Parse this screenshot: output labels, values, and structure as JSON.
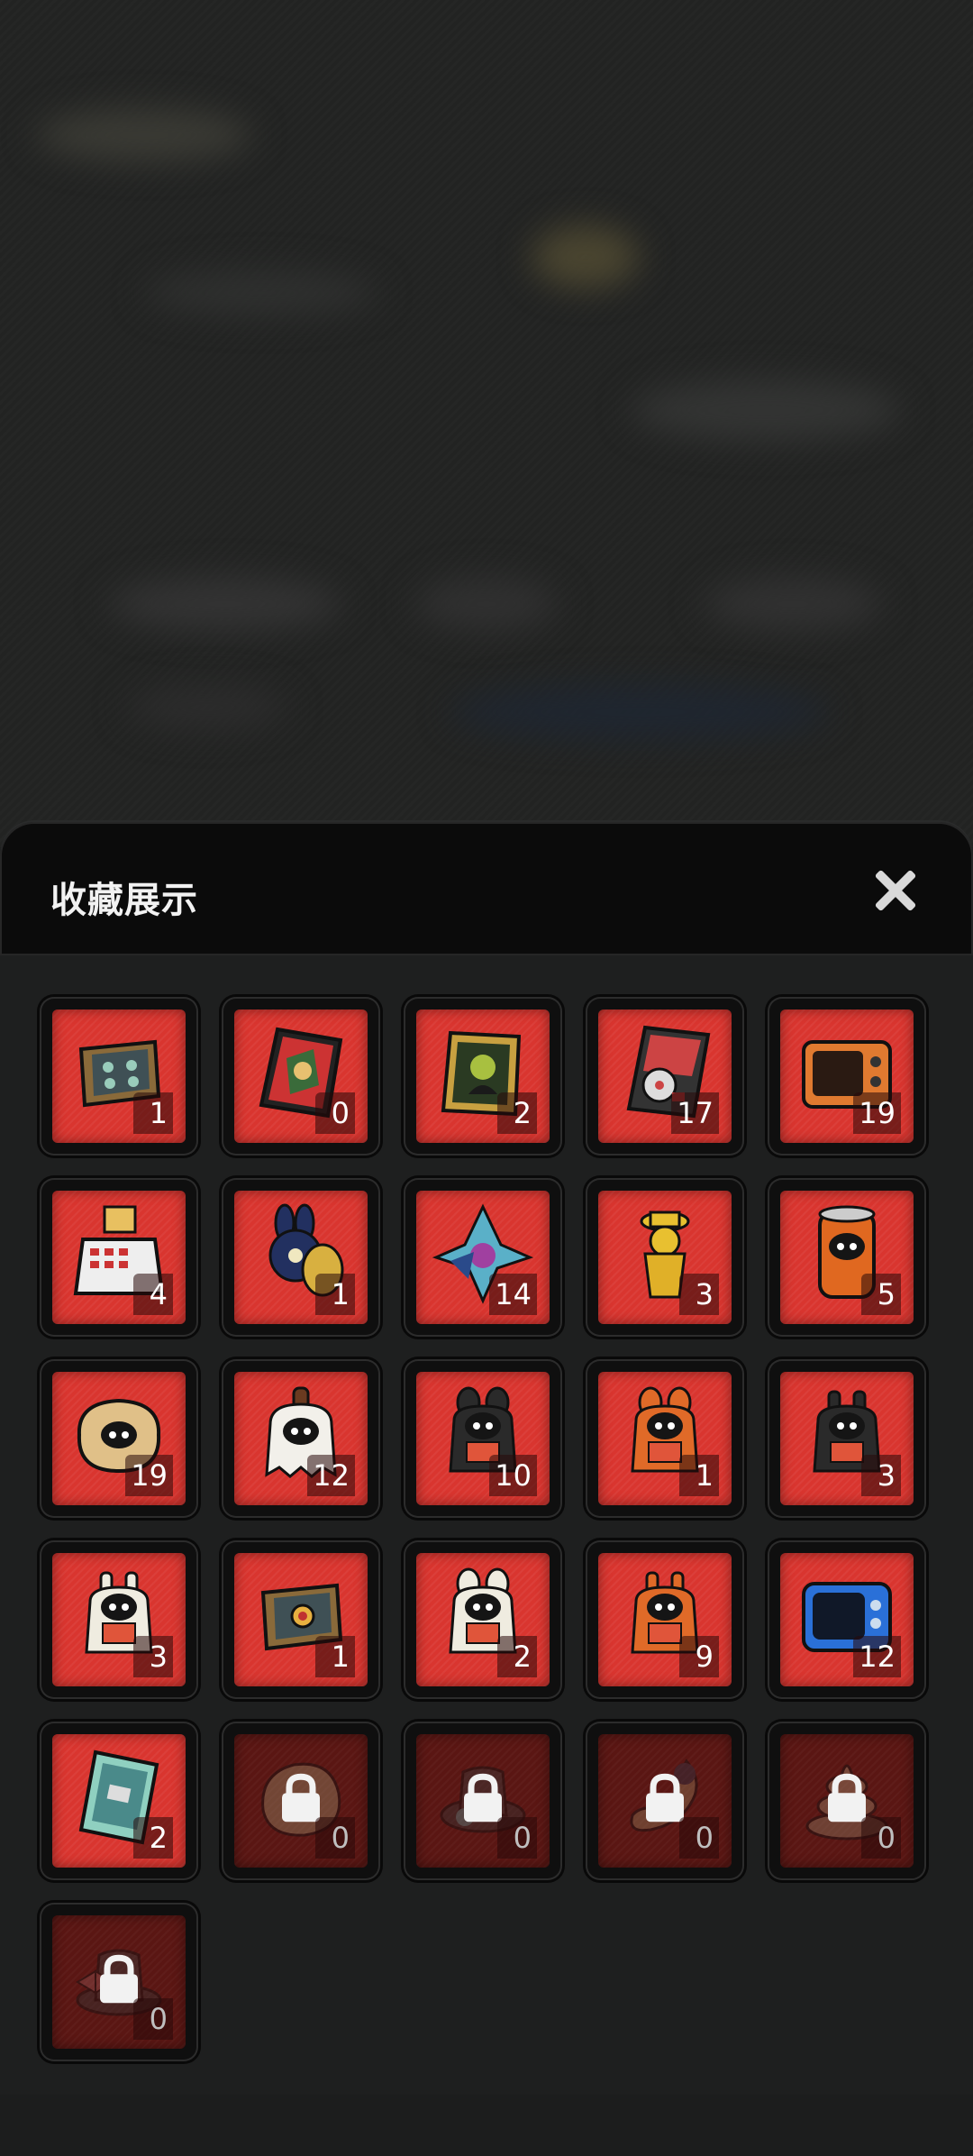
{
  "panel": {
    "title": "收藏展示",
    "close_icon": "close-icon"
  },
  "items": [
    {
      "icon": "tablet-frame-icon",
      "count": "1",
      "locked": false
    },
    {
      "icon": "comic-book-icon",
      "count": "0",
      "locked": false
    },
    {
      "icon": "portrait-frame-icon",
      "count": "2",
      "locked": false
    },
    {
      "icon": "record-album-icon",
      "count": "17",
      "locked": false
    },
    {
      "icon": "retro-tv-icon",
      "count": "19",
      "locked": false
    },
    {
      "icon": "cash-register-icon",
      "count": "4",
      "locked": false
    },
    {
      "icon": "rabbit-figure-icon",
      "count": "1",
      "locked": false
    },
    {
      "icon": "crystal-bird-icon",
      "count": "14",
      "locked": false
    },
    {
      "icon": "golden-detective-icon",
      "count": "3",
      "locked": false
    },
    {
      "icon": "soda-can-icon",
      "count": "5",
      "locked": false
    },
    {
      "icon": "sponge-creature-icon",
      "count": "19",
      "locked": false
    },
    {
      "icon": "ghost-figure-icon",
      "count": "12",
      "locked": false
    },
    {
      "icon": "black-costume-icon",
      "count": "10",
      "locked": false
    },
    {
      "icon": "orange-costume-icon",
      "count": "1",
      "locked": false
    },
    {
      "icon": "black-robot-costume-icon",
      "count": "3",
      "locked": false
    },
    {
      "icon": "white-robot-costume-icon",
      "count": "3",
      "locked": false
    },
    {
      "icon": "gem-frame-icon",
      "count": "1",
      "locked": false
    },
    {
      "icon": "white-costume-icon",
      "count": "2",
      "locked": false
    },
    {
      "icon": "orange-robot-costume-icon",
      "count": "9",
      "locked": false
    },
    {
      "icon": "blue-tv-icon",
      "count": "12",
      "locked": false
    },
    {
      "icon": "card-pack-icon",
      "count": "2",
      "locked": false
    },
    {
      "icon": "rock-icon",
      "count": "0",
      "locked": true
    },
    {
      "icon": "hat-icon",
      "count": "0",
      "locked": true
    },
    {
      "icon": "tail-icon",
      "count": "0",
      "locked": true
    },
    {
      "icon": "poop-icon",
      "count": "0",
      "locked": true
    },
    {
      "icon": "bow-hat-icon",
      "count": "0",
      "locked": true
    }
  ],
  "colors": {
    "slot_red": "#d9352f",
    "slot_locked": "#5a1613",
    "panel_bg": "#1e1f1f",
    "header_bg": "#0b0b0b"
  }
}
